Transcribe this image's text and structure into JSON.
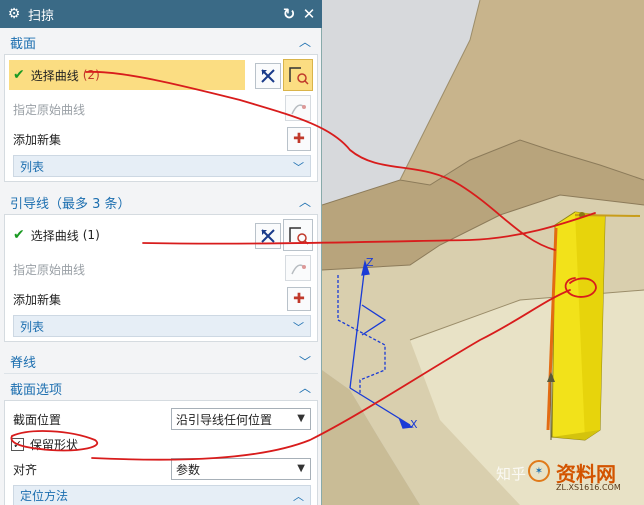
{
  "dialog": {
    "title": "扫掠",
    "reset_icon": "reset-icon",
    "close_icon": "close-icon",
    "section_profile": {
      "header": "截面",
      "select_curve_label": "选择曲线",
      "select_curve_count": "(2)",
      "specify_origin_label": "指定原始曲线",
      "add_new_set_label": "添加新集",
      "list_label": "列表"
    },
    "section_guide": {
      "header": "引导线（最多 3 条）",
      "select_curve_label": "选择曲线",
      "select_curve_count": "(1)",
      "specify_origin_label": "指定原始曲线",
      "add_new_set_label": "添加新集",
      "list_label": "列表"
    },
    "section_spine": {
      "header": "脊线"
    },
    "section_options": {
      "header": "截面选项",
      "position_label": "截面位置",
      "position_value": "沿引导线任何位置",
      "preserve_shape_label": "保留形状",
      "preserve_shape_checked": true,
      "align_label": "对齐",
      "align_value": "参数",
      "orientation_label": "定位方法"
    }
  },
  "viewport": {
    "axis_z": "Z",
    "axis_x": "X"
  },
  "watermark": {
    "text": "资料网",
    "url": "ZL.XS1616.COM",
    "left_text": "知乎"
  },
  "colors": {
    "title_bar": "#3a6a86",
    "section_text": "#1d6fb0",
    "highlight": "#fbdd82",
    "annotation_red": "#d81c1c",
    "sweep_yellow": "#f2e21a"
  }
}
